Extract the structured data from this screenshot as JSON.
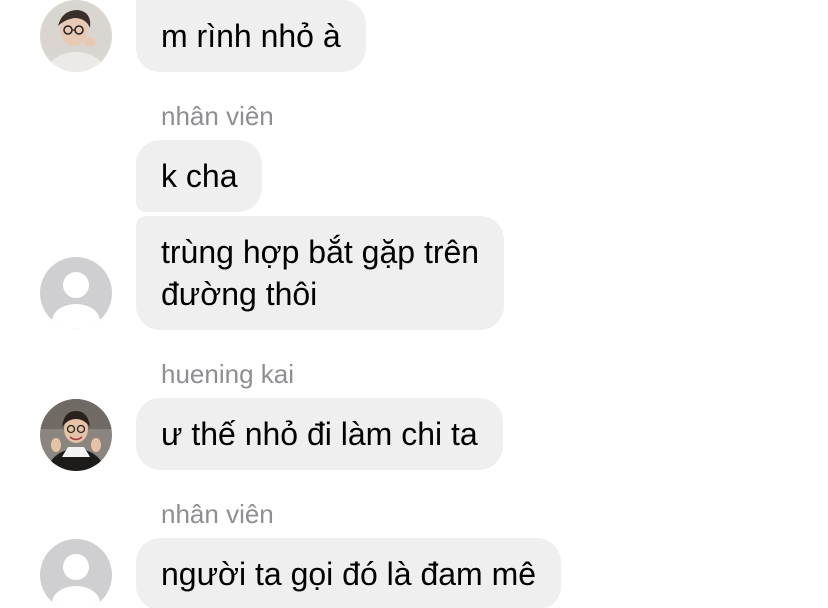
{
  "colors": {
    "bubble": "#efeff0",
    "sender_name": "#8e8e93",
    "text": "#000000",
    "placeholder_avatar": "#cfcfd1"
  },
  "messages": [
    {
      "sender": "",
      "avatar": "photo-avatar-1",
      "lines": [
        "m rình nhỏ à"
      ]
    },
    {
      "sender": "nhân viên",
      "avatar": "",
      "lines": [
        "k cha"
      ]
    },
    {
      "sender": "",
      "avatar": "placeholder-avatar",
      "lines": [
        "trùng hợp bắt gặp trên",
        "đường thôi"
      ]
    },
    {
      "sender": "huening kai",
      "avatar": "photo-avatar-2",
      "lines": [
        "ư thế nhỏ đi làm chi ta"
      ]
    },
    {
      "sender": "nhân viên",
      "avatar": "placeholder-avatar",
      "lines": [
        "người ta gọi đó là đam mê"
      ]
    }
  ]
}
